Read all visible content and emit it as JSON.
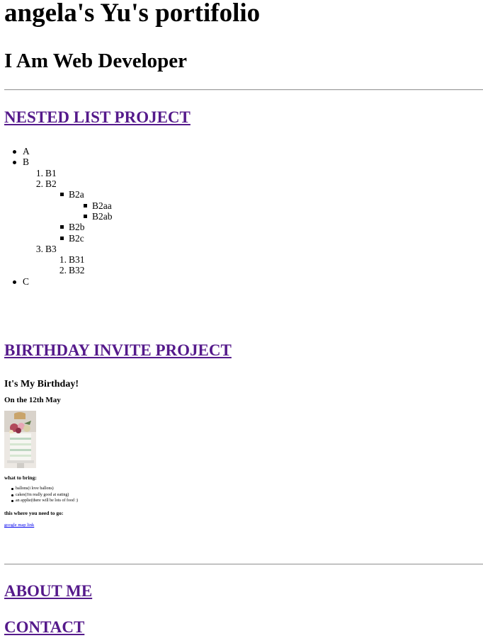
{
  "header": {
    "title": "angela's Yu's portifolio",
    "subtitle": "I Am Web Developer"
  },
  "nested_list": {
    "heading": "NESTED LIST PROJECT",
    "item_a": "A",
    "item_b": "B",
    "b1": "B1",
    "b2": "B2",
    "b2a": "B2a",
    "b2aa": "B2aa",
    "b2ab": "B2ab",
    "b2b": "B2b",
    "b2c": "B2c",
    "b3": "B3",
    "b31": "B31",
    "b32": "B32",
    "item_c": "C",
    "num_1": "1.",
    "num_2": "2.",
    "num_3": "3."
  },
  "birthday": {
    "heading": "BIRTHDAY INVITE PROJECT",
    "title": "It's My Birthday!",
    "date": "On the 12th May",
    "bring_heading": "what to bring:",
    "bring_items": [
      "ballons(i love ballons)",
      "cakes(i'm really good at eating)",
      "an applie(there will be lots of food :)"
    ],
    "where_heading": "this where you need to go:",
    "map_link": "google map link"
  },
  "sections": {
    "about": "ABOUT ME",
    "contact": "CONTACT"
  },
  "colors": {
    "visited_link": "#551a8b",
    "link": "#0000ee",
    "rule": "#9a9a9a"
  }
}
